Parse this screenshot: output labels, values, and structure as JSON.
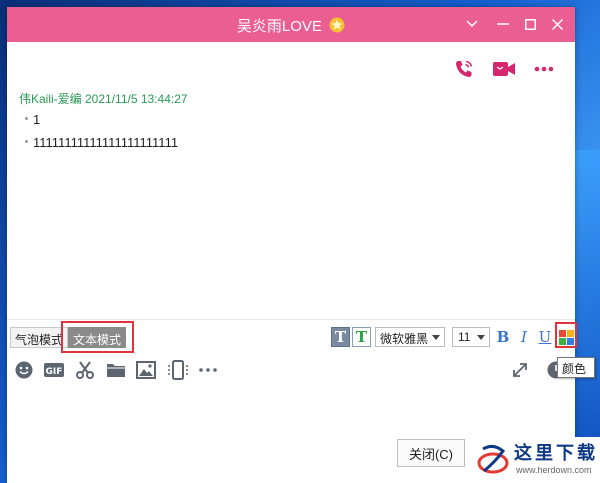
{
  "window": {
    "title": "吴炎雨LOVE",
    "accent_color": "#ea5e92"
  },
  "titlebar_icons": [
    "star-icon",
    "chevron-down-icon",
    "minimize-icon",
    "maximize-icon",
    "close-icon"
  ],
  "top_actions": [
    "phone-call-icon",
    "video-call-icon",
    "more-options-icon"
  ],
  "chat": {
    "sender_line": "伟Kaili-爱编 2021/11/5 13:44:27",
    "messages": [
      "1",
      "11111111111111111111111"
    ]
  },
  "toolbar": {
    "bubble_mode": "气泡模式",
    "text_mode": "文本模式",
    "font_name": "微软雅黑",
    "font_size": "11",
    "bold": "B",
    "italic": "I",
    "underline": "U",
    "color_tooltip": "颜色"
  },
  "input_tools": [
    "emoji-icon",
    "gif-icon",
    "screenshot-scissors-icon",
    "folder-icon",
    "image-icon",
    "phone-screen-icon",
    "more-icon",
    "expand-icon",
    "history-clock-icon"
  ],
  "footer": {
    "close_label": "关闭(C)"
  },
  "watermark": {
    "text": "这里下载",
    "url": "www.herdown.com"
  }
}
